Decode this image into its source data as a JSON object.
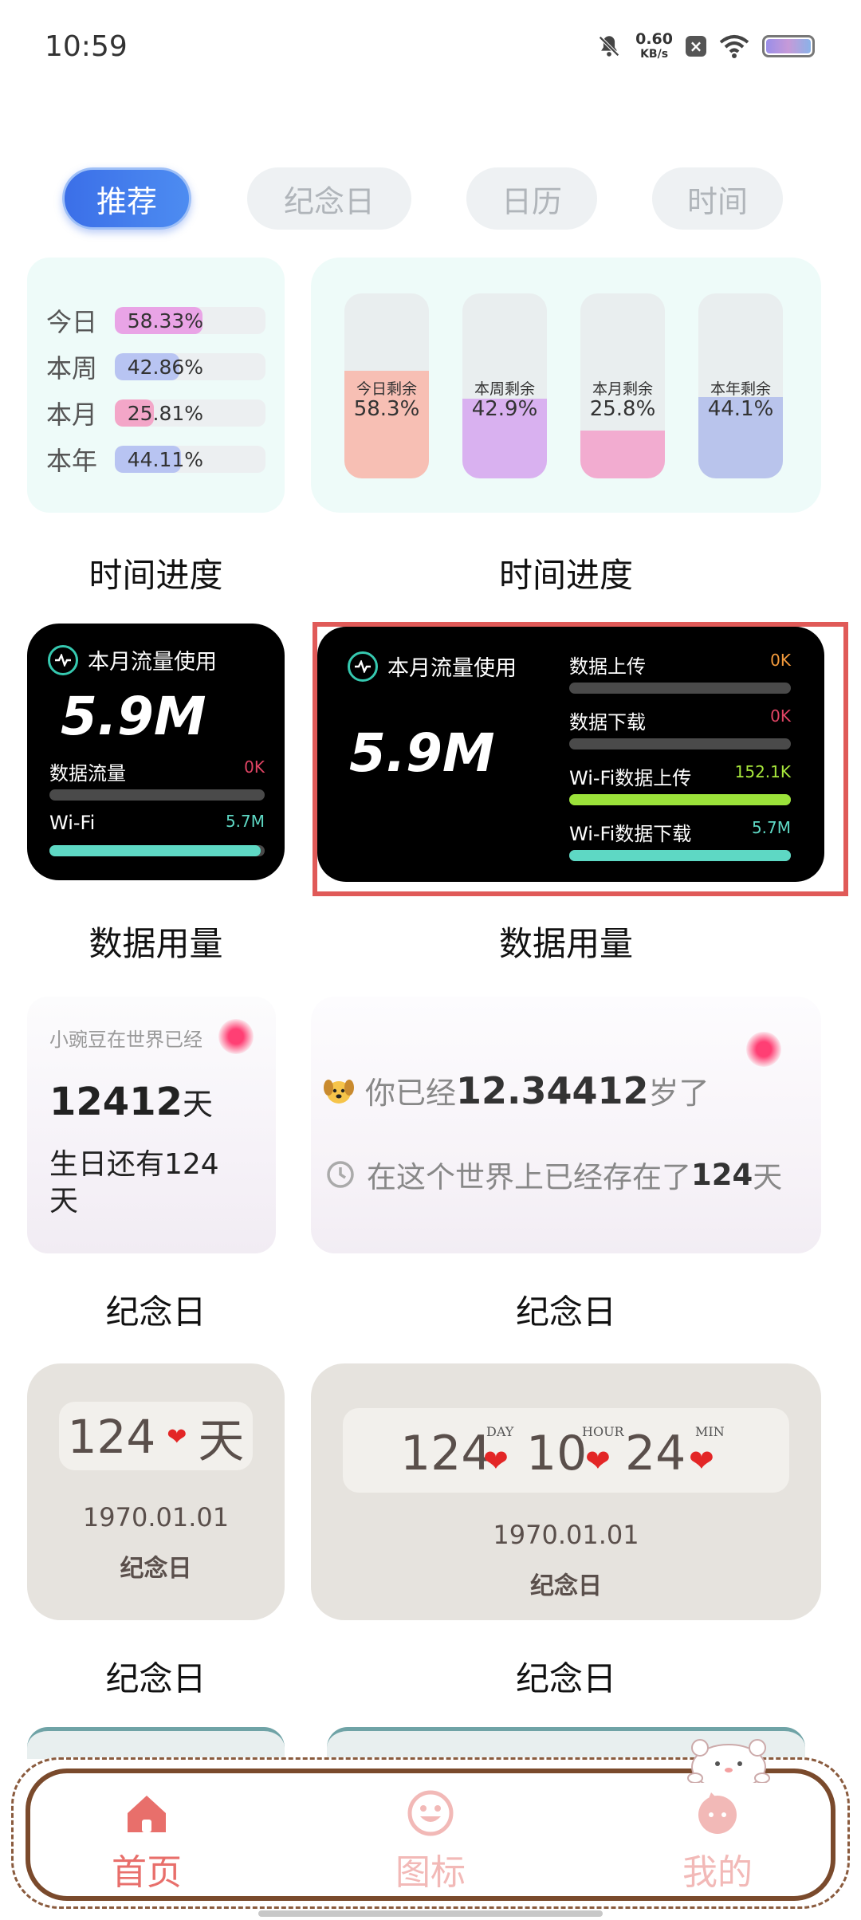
{
  "status_bar": {
    "time": "10:59",
    "speed_value": "0.60",
    "speed_unit": "KB/s"
  },
  "tabs": [
    {
      "label": "推荐",
      "active": true
    },
    {
      "label": "纪念日",
      "active": false
    },
    {
      "label": "日历",
      "active": false
    },
    {
      "label": "时间",
      "active": false
    }
  ],
  "time_progress_list": {
    "rows": [
      {
        "label": "今日",
        "value": "58.33%",
        "percent": 58.33,
        "color": "#e9a4e6"
      },
      {
        "label": "本周",
        "value": "42.86%",
        "percent": 42.86,
        "color": "#b8c4f2"
      },
      {
        "label": "本月",
        "value": "25.81%",
        "percent": 25.81,
        "color": "#f3a6c8"
      },
      {
        "label": "本年",
        "value": "44.11%",
        "percent": 44.11,
        "color": "#b8c4f2"
      }
    ],
    "caption": "时间进度"
  },
  "time_progress_columns": {
    "columns": [
      {
        "label": "今日剩余",
        "value": "58.3%",
        "percent": 58.3,
        "color": "#f7bfb4"
      },
      {
        "label": "本周剩余",
        "value": "42.9%",
        "percent": 42.9,
        "color": "#d9b1f0"
      },
      {
        "label": "本月剩余",
        "value": "25.8%",
        "percent": 25.8,
        "color": "#f2acd0"
      },
      {
        "label": "本年剩余",
        "value": "44.1%",
        "percent": 44.1,
        "color": "#b9c4ec"
      }
    ],
    "caption": "时间进度"
  },
  "data_usage_small": {
    "title": "本月流量使用",
    "total": "5.9M",
    "rows": [
      {
        "label": "数据流量",
        "value": "0K",
        "percent": 0,
        "color": "#e04464",
        "bar_color": "#4a4a4a"
      },
      {
        "label": "Wi-Fi",
        "value": "5.7M",
        "percent": 98,
        "color": "#5ed8c4",
        "bar_color": "#5ed8c4"
      }
    ],
    "caption": "数据用量"
  },
  "data_usage_large": {
    "title": "本月流量使用",
    "total": "5.9M",
    "rows": [
      {
        "label": "数据上传",
        "value": "0K",
        "percent": 0,
        "color": "#f39a3c",
        "bar_color": "#4a4a4a"
      },
      {
        "label": "数据下载",
        "value": "0K",
        "percent": 0,
        "color": "#e04464",
        "bar_color": "#4a4a4a"
      },
      {
        "label": "Wi-Fi数据上传",
        "value": "152.1K",
        "percent": 100,
        "color": "#a8e83c",
        "bar_color": "#9be23a"
      },
      {
        "label": "Wi-Fi数据下载",
        "value": "5.7M",
        "percent": 100,
        "color": "#5ed8c4",
        "bar_color": "#5ed8c4"
      }
    ],
    "caption": "数据用量"
  },
  "anniversary_small": {
    "header": "小豌豆在世界已经",
    "days_number": "12412",
    "days_unit": "天",
    "birthday_line1": "生日还有124",
    "birthday_line2": "天",
    "caption": "纪念日"
  },
  "anniversary_large": {
    "age_prefix": "你已经",
    "age_value": "12.34412",
    "age_suffix": "岁了",
    "exist_prefix": "在这个世界上已经存在了",
    "exist_value": "124",
    "exist_suffix": "天",
    "caption": "纪念日"
  },
  "countdown_small": {
    "days": "124",
    "heart": "❤",
    "unit": "天",
    "date": "1970.01.01",
    "name": "纪念日",
    "caption": "纪念日"
  },
  "countdown_large": {
    "days": "124",
    "day_label": "DAY",
    "hours": "10",
    "hour_label": "HOUR",
    "minutes": "24",
    "min_label": "MIN",
    "heart": "❤",
    "date": "1970.01.01",
    "name": "纪念日",
    "caption": "纪念日"
  },
  "bottom_nav": [
    {
      "label": "首页",
      "icon": "home-icon",
      "active": true,
      "color": "#e86f6b"
    },
    {
      "label": "图标",
      "icon": "smiley-icon",
      "active": false,
      "color": "#f2b9b7"
    },
    {
      "label": "我的",
      "icon": "profile-icon",
      "active": false,
      "color": "#f2b9b7"
    }
  ]
}
